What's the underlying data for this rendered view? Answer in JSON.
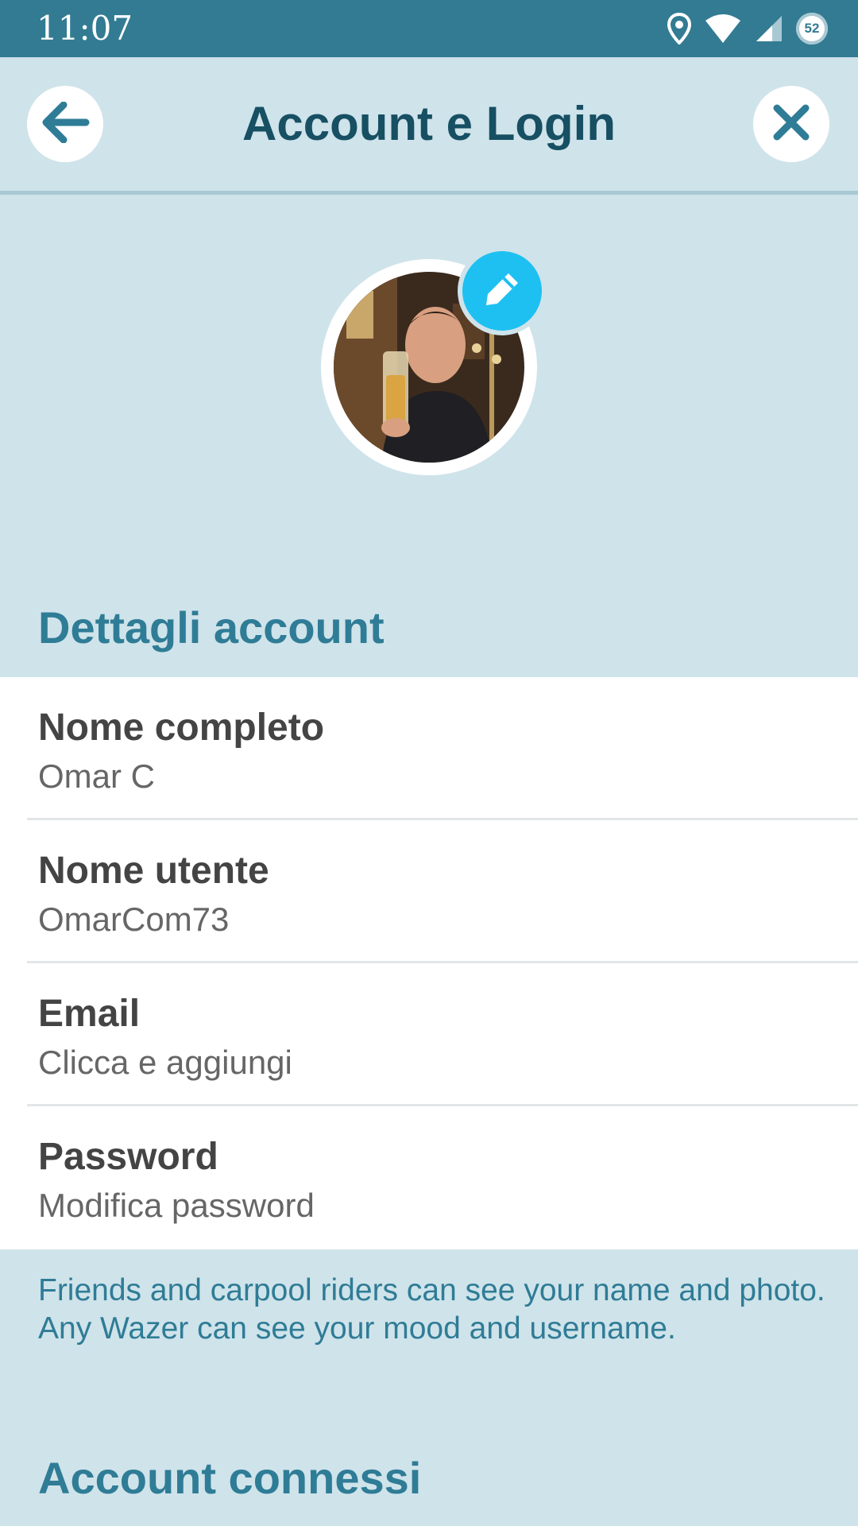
{
  "status_bar": {
    "time": "11:07",
    "battery_level": "52",
    "icons": [
      "location-icon",
      "wifi-icon",
      "cell-signal-icon",
      "battery-saver-icon"
    ]
  },
  "header": {
    "title": "Account e Login",
    "back_icon": "arrow-left-icon",
    "close_icon": "close-icon"
  },
  "profile": {
    "edit_icon": "pencil-icon"
  },
  "account_details": {
    "title": "Dettagli account",
    "rows": [
      {
        "label": "Nome completo",
        "value": "Omar C"
      },
      {
        "label": "Nome utente",
        "value": "OmarCom73"
      },
      {
        "label": "Email",
        "value": "Clicca e aggiungi"
      },
      {
        "label": "Password",
        "value": "Modifica password"
      }
    ]
  },
  "privacy_note": "Friends and carpool riders can see your name and photo. Any Wazer can see your mood and username.",
  "connected_accounts": {
    "title": "Account connessi"
  },
  "colors": {
    "status_bar": "#327b93",
    "background": "#cfe3ea",
    "title": "#174f63",
    "section_title": "#2f7c96",
    "edit_badge": "#1ec0f2"
  }
}
